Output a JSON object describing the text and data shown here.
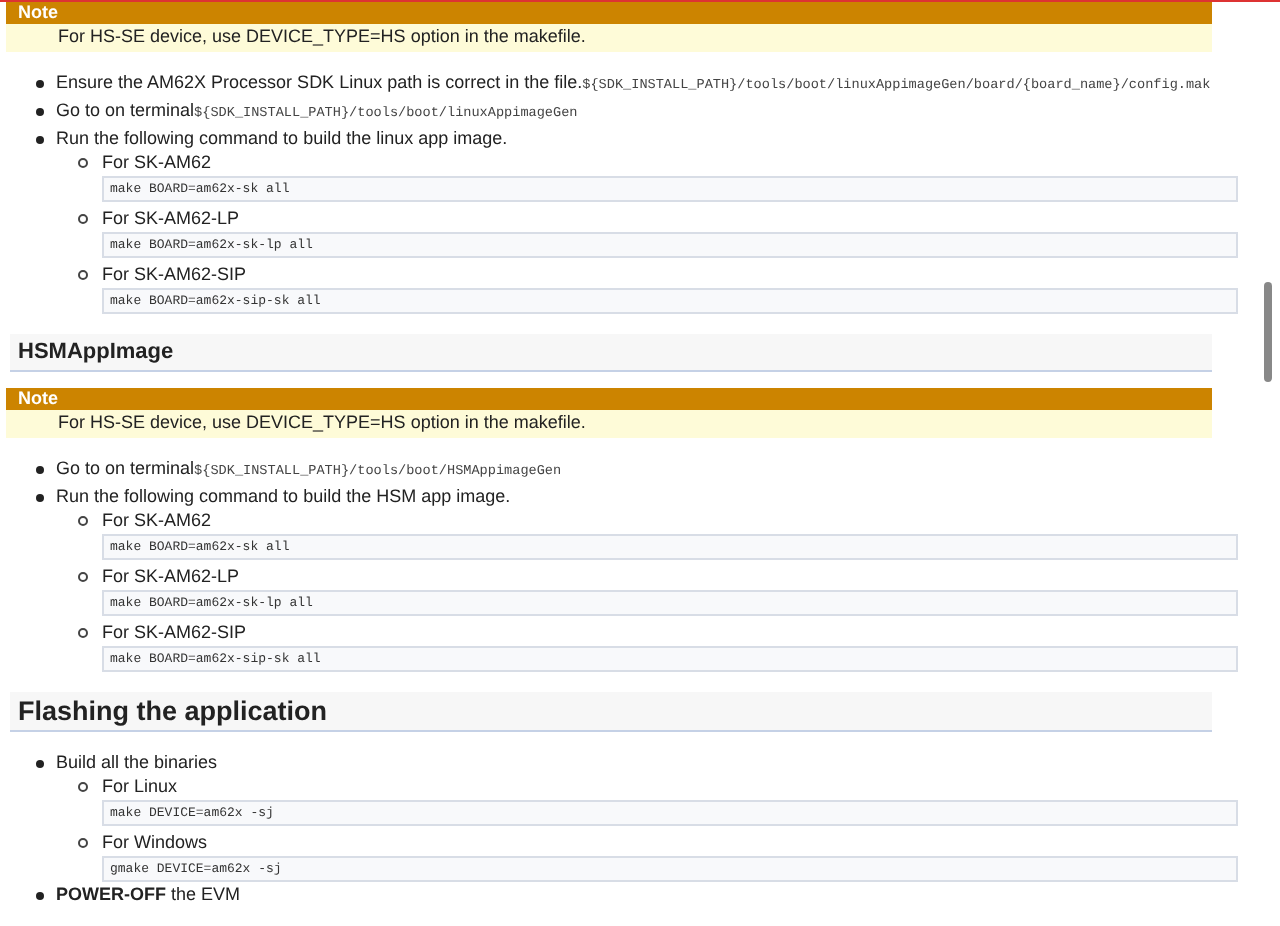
{
  "blocks": [
    {
      "kind": "note",
      "title": "Note",
      "text": "For HS-SE device, use DEVICE_TYPE=HS option in the makefile."
    },
    {
      "kind": "list",
      "items": [
        {
          "text": "Ensure the AM62X Processor SDK Linux path is correct in the file.",
          "code": "${SDK_INSTALL_PATH}/tools/boot/linuxAppimageGen/board/{board_name}/config.mak"
        },
        {
          "text": "Go to on terminal",
          "code": "${SDK_INSTALL_PATH}/tools/boot/linuxAppimageGen"
        },
        {
          "text": "Run the following command to build the linux app image.",
          "children": [
            {
              "text": "For SK-AM62",
              "block": "make BOARD=am62x-sk all"
            },
            {
              "text": "For SK-AM62-LP",
              "block": "make BOARD=am62x-sk-lp all"
            },
            {
              "text": "For SK-AM62-SIP",
              "block": "make BOARD=am62x-sip-sk all"
            }
          ]
        }
      ]
    },
    {
      "kind": "subheading",
      "text": "HSMAppImage"
    },
    {
      "kind": "note",
      "title": "Note",
      "text": "For HS-SE device, use DEVICE_TYPE=HS option in the makefile."
    },
    {
      "kind": "list",
      "items": [
        {
          "text": "Go to on terminal",
          "code": "${SDK_INSTALL_PATH}/tools/boot/HSMAppimageGen"
        },
        {
          "text": "Run the following command to build the HSM app image.",
          "children": [
            {
              "text": "For SK-AM62",
              "block": "make BOARD=am62x-sk all"
            },
            {
              "text": "For SK-AM62-LP",
              "block": "make BOARD=am62x-sk-lp all"
            },
            {
              "text": "For SK-AM62-SIP",
              "block": "make BOARD=am62x-sip-sk all"
            }
          ]
        }
      ]
    },
    {
      "kind": "heading",
      "text": "Flashing the application"
    },
    {
      "kind": "list",
      "items": [
        {
          "text": "Build all the binaries",
          "children": [
            {
              "text": "For Linux",
              "block": "make DEVICE=am62x -sj"
            },
            {
              "text": "For Windows",
              "block": "gmake DEVICE=am62x -sj"
            }
          ]
        },
        {
          "text": "**POWER-OFF** the EVM"
        }
      ]
    }
  ]
}
